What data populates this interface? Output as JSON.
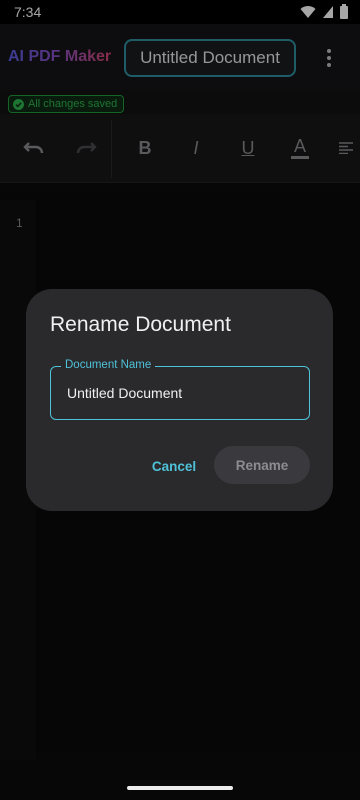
{
  "status_bar": {
    "time": "7:34",
    "icons": [
      "wifi-icon",
      "signal-icon",
      "battery-icon"
    ]
  },
  "app_bar": {
    "brand": "AI PDF Maker",
    "document_title": "Untitled Document",
    "more_icon": "more-vert-icon"
  },
  "save_status": {
    "text": "All changes saved",
    "icon": "check-circle-icon",
    "color": "#2fb24d"
  },
  "toolbar": {
    "items": [
      {
        "name": "undo",
        "icon": "undo-icon"
      },
      {
        "name": "redo",
        "icon": "redo-icon"
      },
      {
        "name": "bold",
        "glyph": "B"
      },
      {
        "name": "italic",
        "glyph": "I"
      },
      {
        "name": "underline",
        "glyph": "U"
      },
      {
        "name": "text-color",
        "glyph": "A"
      },
      {
        "name": "align",
        "icon": "align-left-icon"
      }
    ]
  },
  "editor": {
    "line_number": "1"
  },
  "dialog": {
    "title": "Rename Document",
    "field_label": "Document Name",
    "field_value": "Untitled Document",
    "cancel_label": "Cancel",
    "rename_label": "Rename",
    "accent_color": "#4fc1d8"
  }
}
